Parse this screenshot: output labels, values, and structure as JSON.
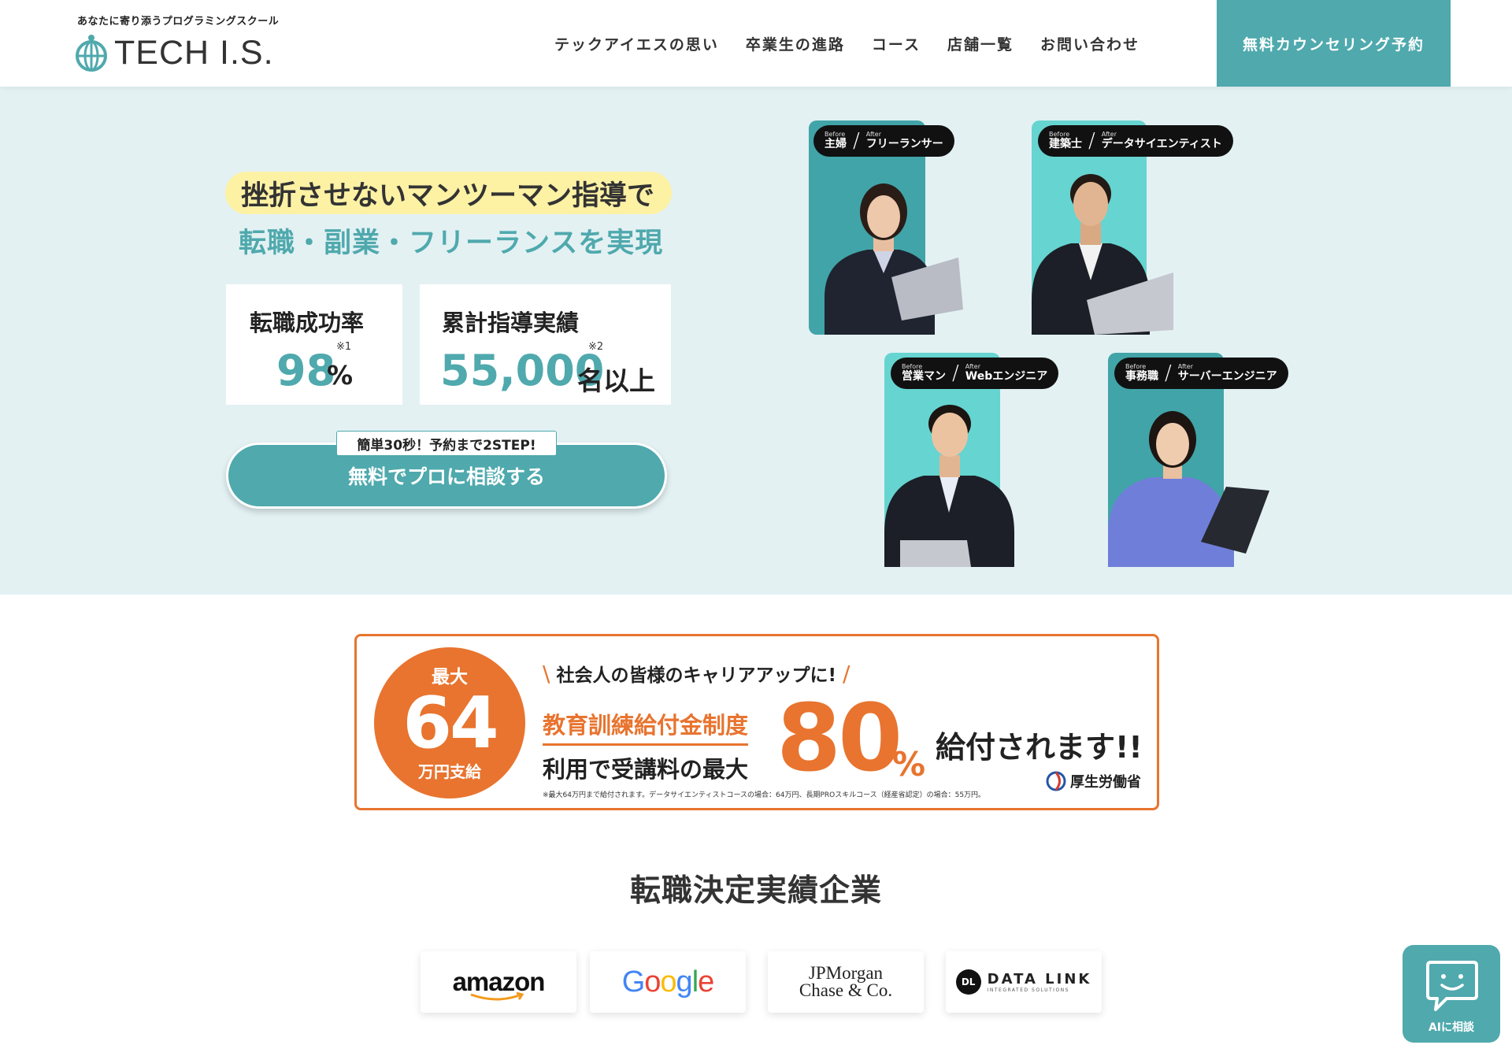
{
  "header": {
    "tagline": "あなたに寄り添うプログラミングスクール",
    "logo_text": "TECH I.S.",
    "nav": [
      "テックアイエスの思い",
      "卒業生の進路",
      "コース",
      "店舗一覧",
      "お問い合わせ"
    ],
    "cta_label": "無料カウンセリング予約"
  },
  "hero": {
    "headline_line1": "挫折させないマンツーマン指導で",
    "headline_line2": "転職・副業・フリーランスを実現",
    "stats": [
      {
        "label": "転職成功率",
        "note": "※1",
        "value": "98",
        "unit": "%"
      },
      {
        "label": "累計指導実績",
        "note": "※2",
        "value": "55,000",
        "unit": "名以上"
      }
    ],
    "cta_bubble": "簡単30秒！予約まで2STEP!",
    "cta_button": "無料でプロに相談する",
    "people": [
      {
        "before_tag": "Before",
        "before": "主婦",
        "after_tag": "After",
        "after": "フリーランサー"
      },
      {
        "before_tag": "Before",
        "before": "建築士",
        "after_tag": "After",
        "after": "データサイエンティスト"
      },
      {
        "before_tag": "Before",
        "before": "営業マン",
        "after_tag": "After",
        "after": "Webエンジニア"
      },
      {
        "before_tag": "Before",
        "before": "事務職",
        "after_tag": "After",
        "after": "サーバーエンジニア"
      }
    ]
  },
  "banner": {
    "badge_top": "最大",
    "badge_num": "64",
    "badge_bottom": "万円支給",
    "subtitle": "社会人の皆様のキャリアアップに!",
    "system": "教育訓練給付金制度",
    "use_line": "利用で受講料の最大",
    "big_number": "80",
    "percent": "%",
    "paid": "給付されます!!",
    "note": "※最大64万円まで給付されます。データサイエンティストコースの場合：64万円、長期PROスキルコース（経産省認定）の場合：55万円。",
    "ministry": "厚生労働省"
  },
  "companies": {
    "title": "転職決定実績企業",
    "logos": [
      "amazon",
      "Google",
      "JPMorgan Chase & Co.",
      "DATA LINK"
    ],
    "jpm_line1": "JPMorgan",
    "jpm_line2": "Chase & Co.",
    "datalink_mark": "DL",
    "datalink_main": "DATA LINK",
    "datalink_sub": "INTEGRATED SOLUTIONS"
  },
  "ai_chat": {
    "label": "AIに相談",
    "icon": "chat-bubble-icon"
  },
  "colors": {
    "teal": "#4fa9ad",
    "hero_bg": "#e3f1f3",
    "orange": "#e8742f",
    "highlight": "#fdf1a4"
  }
}
